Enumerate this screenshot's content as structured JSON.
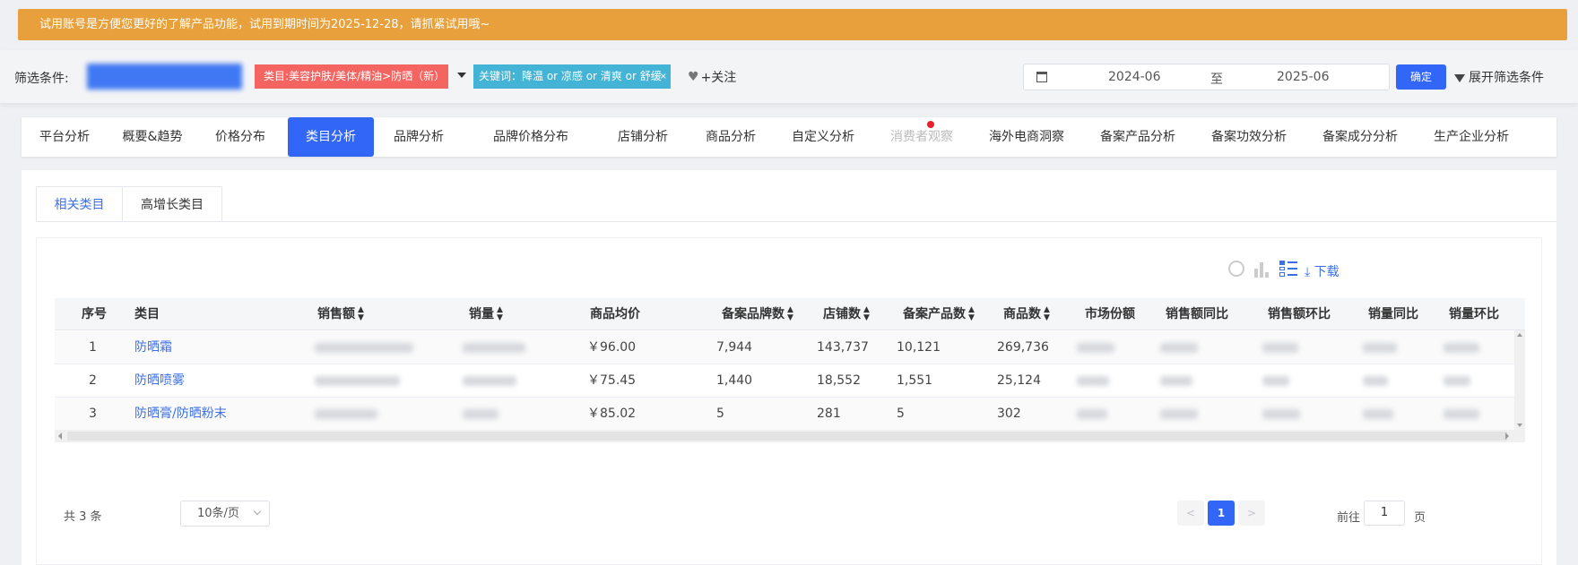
{
  "banner": {
    "text": "试用账号是方便您更好的了解产品功能，试用到期时间为2025-12-28，请抓紧试用哦~"
  },
  "filter": {
    "label": "筛选条件:",
    "category_chip": "类目:美容护肤/美体/精油>防晒（新）",
    "keyword_chip": "关键词：降温 or 凉感 or 清爽 or 舒缓",
    "keyword_close": "×",
    "follow_label": "+关注",
    "date_start": "2024-06",
    "date_sep": "至",
    "date_end": "2025-06",
    "confirm_label": "确定",
    "expand_label": "展开筛选条件"
  },
  "tabs": [
    {
      "label": "平台分析"
    },
    {
      "label": "概要&趋势"
    },
    {
      "label": "价格分布"
    },
    {
      "label": "类目分析"
    },
    {
      "label": "品牌分析"
    },
    {
      "label": "品牌价格分布"
    },
    {
      "label": "店铺分析"
    },
    {
      "label": "商品分析"
    },
    {
      "label": "自定义分析"
    },
    {
      "label": "消费者观察"
    },
    {
      "label": "海外电商洞察"
    },
    {
      "label": "备案产品分析"
    },
    {
      "label": "备案功效分析"
    },
    {
      "label": "备案成分分析"
    },
    {
      "label": "生产企业分析"
    }
  ],
  "active_tab": "类目分析",
  "subtabs": [
    {
      "label": "相关类目"
    },
    {
      "label": "高增长类目"
    }
  ],
  "toolbar": {
    "download_label": "下载"
  },
  "table": {
    "columns": [
      "序号",
      "类目",
      "销售额",
      "销量",
      "商品均价",
      "备案品牌数",
      "店铺数",
      "备案产品数",
      "商品数",
      "市场份额",
      "销售额同比",
      "销售额环比",
      "销量同比",
      "销量环比"
    ],
    "rows": [
      {
        "idx": "1",
        "category": "防晒霜",
        "avg_price": "￥96.00",
        "brands": "7,944",
        "shops": "143,737",
        "products": "10,121",
        "items": "269,736"
      },
      {
        "idx": "2",
        "category": "防晒喷雾",
        "avg_price": "￥75.45",
        "brands": "1,440",
        "shops": "18,552",
        "products": "1,551",
        "items": "25,124"
      },
      {
        "idx": "3",
        "category": "防晒膏/防晒粉末",
        "avg_price": "￥85.02",
        "brands": "5",
        "shops": "281",
        "products": "5",
        "items": "302"
      }
    ]
  },
  "pagination": {
    "total": "共 3 条",
    "page_size": "10条/页",
    "current_page": "1",
    "goto_prefix": "前往",
    "goto_value": "1",
    "goto_suffix": "页"
  }
}
